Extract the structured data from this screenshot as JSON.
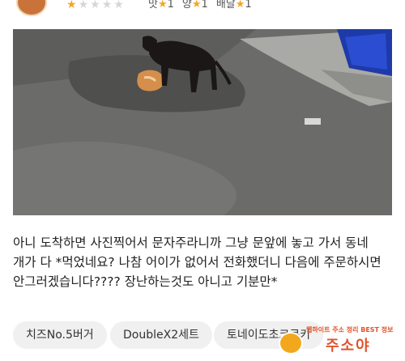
{
  "header": {
    "rating_stars": 1,
    "rating_max": 5,
    "scores": [
      {
        "label": "맛",
        "value": "1"
      },
      {
        "label": "양",
        "value": "1"
      },
      {
        "label": "배달",
        "value": "1"
      }
    ],
    "star_glyph": "★"
  },
  "photo": {
    "subject": "dog-eating-delivered-food-on-street"
  },
  "review": {
    "text": "아니 도착하면 사진찍어서 문자주라니까 그냥 문앞에 놓고 가서 동네 개가 다 *먹었네요? 나참 어이가 없어서 전화했더니 다음에 주문하시면 안그러겠습니다???? 장난하는것도 아니고 기분만*"
  },
  "menu_tags": [
    {
      "label": "치즈No.5버거"
    },
    {
      "label": "DoubleX2세트"
    },
    {
      "label": "토네이도초코쿠키"
    }
  ],
  "watermark": {
    "top_text": "웹하이트 주소 정리 BEST 정보",
    "main_text": "주소야"
  },
  "colors": {
    "star_on": "#f5a623",
    "star_off": "#d6d6d6",
    "chip_bg": "#f0f0f0",
    "watermark": "#e0542c"
  }
}
